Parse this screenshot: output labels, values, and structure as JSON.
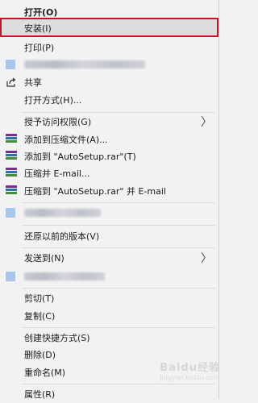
{
  "menu": {
    "open": "打开(O)",
    "install": "安装(I)",
    "print": "打印(P)",
    "share": "共享",
    "open_with": "打开方式(H)...",
    "grant_access": "授予访问权限(G)",
    "add_to_archive": "添加到压缩文件(A)...",
    "add_to_rar": "添加到 \"AutoSetup.rar\"(T)",
    "compress_email": "压缩并 E-mail...",
    "compress_rar_email": "压缩到 \"AutoSetup.rar\" 并 E-mail",
    "restore_versions": "还原以前的版本(V)",
    "send_to": "发送到(N)",
    "cut": "剪切(T)",
    "copy": "复制(C)",
    "create_shortcut": "创建快捷方式(S)",
    "delete": "删除(D)",
    "rename": "重命名(M)",
    "properties": "属性(R)"
  },
  "submenu_arrow": "〉",
  "watermark": {
    "brand": "Baidu经验",
    "url": "jingyan.baidu.com"
  },
  "colors": {
    "highlight_border": "#c8102e",
    "menu_bg": "#f2f2f2"
  }
}
